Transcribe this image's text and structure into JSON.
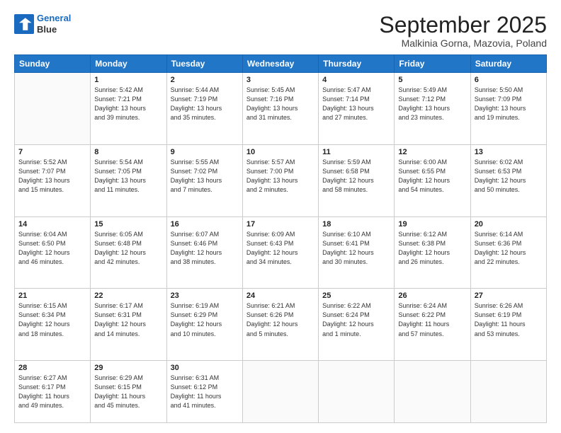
{
  "header": {
    "logo_line1": "General",
    "logo_line2": "Blue",
    "month": "September 2025",
    "location": "Malkinia Gorna, Mazovia, Poland"
  },
  "weekdays": [
    "Sunday",
    "Monday",
    "Tuesday",
    "Wednesday",
    "Thursday",
    "Friday",
    "Saturday"
  ],
  "weeks": [
    [
      {
        "day": "",
        "info": ""
      },
      {
        "day": "1",
        "info": "Sunrise: 5:42 AM\nSunset: 7:21 PM\nDaylight: 13 hours\nand 39 minutes."
      },
      {
        "day": "2",
        "info": "Sunrise: 5:44 AM\nSunset: 7:19 PM\nDaylight: 13 hours\nand 35 minutes."
      },
      {
        "day": "3",
        "info": "Sunrise: 5:45 AM\nSunset: 7:16 PM\nDaylight: 13 hours\nand 31 minutes."
      },
      {
        "day": "4",
        "info": "Sunrise: 5:47 AM\nSunset: 7:14 PM\nDaylight: 13 hours\nand 27 minutes."
      },
      {
        "day": "5",
        "info": "Sunrise: 5:49 AM\nSunset: 7:12 PM\nDaylight: 13 hours\nand 23 minutes."
      },
      {
        "day": "6",
        "info": "Sunrise: 5:50 AM\nSunset: 7:09 PM\nDaylight: 13 hours\nand 19 minutes."
      }
    ],
    [
      {
        "day": "7",
        "info": "Sunrise: 5:52 AM\nSunset: 7:07 PM\nDaylight: 13 hours\nand 15 minutes."
      },
      {
        "day": "8",
        "info": "Sunrise: 5:54 AM\nSunset: 7:05 PM\nDaylight: 13 hours\nand 11 minutes."
      },
      {
        "day": "9",
        "info": "Sunrise: 5:55 AM\nSunset: 7:02 PM\nDaylight: 13 hours\nand 7 minutes."
      },
      {
        "day": "10",
        "info": "Sunrise: 5:57 AM\nSunset: 7:00 PM\nDaylight: 13 hours\nand 2 minutes."
      },
      {
        "day": "11",
        "info": "Sunrise: 5:59 AM\nSunset: 6:58 PM\nDaylight: 12 hours\nand 58 minutes."
      },
      {
        "day": "12",
        "info": "Sunrise: 6:00 AM\nSunset: 6:55 PM\nDaylight: 12 hours\nand 54 minutes."
      },
      {
        "day": "13",
        "info": "Sunrise: 6:02 AM\nSunset: 6:53 PM\nDaylight: 12 hours\nand 50 minutes."
      }
    ],
    [
      {
        "day": "14",
        "info": "Sunrise: 6:04 AM\nSunset: 6:50 PM\nDaylight: 12 hours\nand 46 minutes."
      },
      {
        "day": "15",
        "info": "Sunrise: 6:05 AM\nSunset: 6:48 PM\nDaylight: 12 hours\nand 42 minutes."
      },
      {
        "day": "16",
        "info": "Sunrise: 6:07 AM\nSunset: 6:46 PM\nDaylight: 12 hours\nand 38 minutes."
      },
      {
        "day": "17",
        "info": "Sunrise: 6:09 AM\nSunset: 6:43 PM\nDaylight: 12 hours\nand 34 minutes."
      },
      {
        "day": "18",
        "info": "Sunrise: 6:10 AM\nSunset: 6:41 PM\nDaylight: 12 hours\nand 30 minutes."
      },
      {
        "day": "19",
        "info": "Sunrise: 6:12 AM\nSunset: 6:38 PM\nDaylight: 12 hours\nand 26 minutes."
      },
      {
        "day": "20",
        "info": "Sunrise: 6:14 AM\nSunset: 6:36 PM\nDaylight: 12 hours\nand 22 minutes."
      }
    ],
    [
      {
        "day": "21",
        "info": "Sunrise: 6:15 AM\nSunset: 6:34 PM\nDaylight: 12 hours\nand 18 minutes."
      },
      {
        "day": "22",
        "info": "Sunrise: 6:17 AM\nSunset: 6:31 PM\nDaylight: 12 hours\nand 14 minutes."
      },
      {
        "day": "23",
        "info": "Sunrise: 6:19 AM\nSunset: 6:29 PM\nDaylight: 12 hours\nand 10 minutes."
      },
      {
        "day": "24",
        "info": "Sunrise: 6:21 AM\nSunset: 6:26 PM\nDaylight: 12 hours\nand 5 minutes."
      },
      {
        "day": "25",
        "info": "Sunrise: 6:22 AM\nSunset: 6:24 PM\nDaylight: 12 hours\nand 1 minute."
      },
      {
        "day": "26",
        "info": "Sunrise: 6:24 AM\nSunset: 6:22 PM\nDaylight: 11 hours\nand 57 minutes."
      },
      {
        "day": "27",
        "info": "Sunrise: 6:26 AM\nSunset: 6:19 PM\nDaylight: 11 hours\nand 53 minutes."
      }
    ],
    [
      {
        "day": "28",
        "info": "Sunrise: 6:27 AM\nSunset: 6:17 PM\nDaylight: 11 hours\nand 49 minutes."
      },
      {
        "day": "29",
        "info": "Sunrise: 6:29 AM\nSunset: 6:15 PM\nDaylight: 11 hours\nand 45 minutes."
      },
      {
        "day": "30",
        "info": "Sunrise: 6:31 AM\nSunset: 6:12 PM\nDaylight: 11 hours\nand 41 minutes."
      },
      {
        "day": "",
        "info": ""
      },
      {
        "day": "",
        "info": ""
      },
      {
        "day": "",
        "info": ""
      },
      {
        "day": "",
        "info": ""
      }
    ]
  ]
}
